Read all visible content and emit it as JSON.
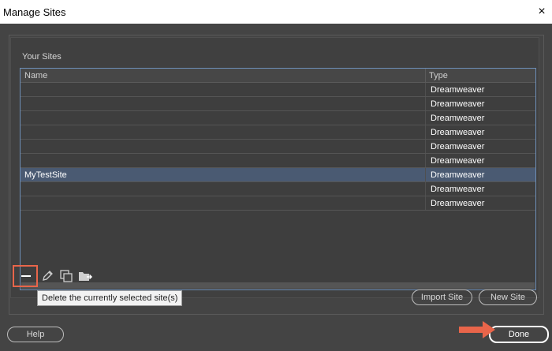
{
  "window": {
    "title": "Manage Sites",
    "close_glyph": "×"
  },
  "sites": {
    "group_label": "Your Sites",
    "columns": {
      "name": "Name",
      "type": "Type"
    },
    "rows": [
      {
        "name": "",
        "type": "Dreamweaver",
        "selected": false
      },
      {
        "name": "",
        "type": "Dreamweaver",
        "selected": false
      },
      {
        "name": "",
        "type": "Dreamweaver",
        "selected": false
      },
      {
        "name": "",
        "type": "Dreamweaver",
        "selected": false
      },
      {
        "name": "",
        "type": "Dreamweaver",
        "selected": false
      },
      {
        "name": "",
        "type": "Dreamweaver",
        "selected": false
      },
      {
        "name": "MyTestSite",
        "type": "Dreamweaver",
        "selected": true
      },
      {
        "name": "",
        "type": "Dreamweaver",
        "selected": false
      },
      {
        "name": "",
        "type": "Dreamweaver",
        "selected": false
      }
    ]
  },
  "toolbar": {
    "icons": [
      "minus-icon",
      "pencil-icon",
      "duplicate-icon",
      "export-icon"
    ],
    "tooltip": "Delete the currently selected site(s)"
  },
  "buttons": {
    "import": "Import Site",
    "new": "New Site",
    "help": "Help",
    "done": "Done"
  },
  "colors": {
    "highlight": "#e8654a",
    "selection": "#4a5a72",
    "table_border": "#6e8fb8"
  }
}
